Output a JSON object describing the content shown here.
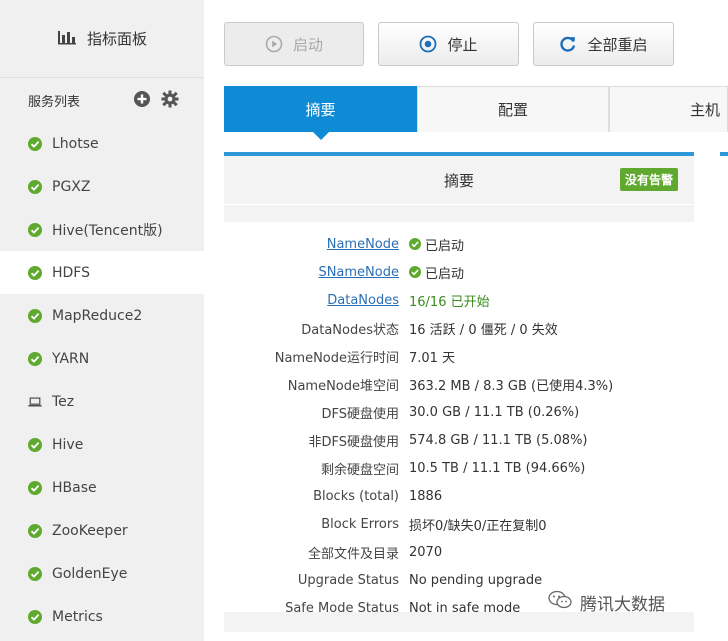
{
  "sidebar": {
    "title": "指标面板",
    "services_label": "服务列表",
    "items": [
      {
        "label": "Lhotse",
        "icon": "check-circle-icon"
      },
      {
        "label": "PGXZ",
        "icon": "check-circle-icon"
      },
      {
        "label": "Hive(Tencent版)",
        "icon": "check-circle-icon"
      },
      {
        "label": "HDFS",
        "icon": "none",
        "active": true
      },
      {
        "label": "MapReduce2",
        "icon": "check-circle-icon"
      },
      {
        "label": "YARN",
        "icon": "check-circle-icon"
      },
      {
        "label": "Tez",
        "icon": "laptop-icon"
      },
      {
        "label": "Hive",
        "icon": "check-circle-icon"
      },
      {
        "label": "HBase",
        "icon": "check-circle-icon"
      },
      {
        "label": "ZooKeeper",
        "icon": "check-circle-icon"
      },
      {
        "label": "GoldenEye",
        "icon": "check-circle-icon"
      },
      {
        "label": "Metrics",
        "icon": "check-circle-icon"
      }
    ]
  },
  "toolbar": {
    "start_label": "启动",
    "stop_label": "停止",
    "restart_label": "全部重启"
  },
  "tabs": [
    {
      "label": "摘要",
      "active": true
    },
    {
      "label": "配置"
    },
    {
      "label": "主机"
    }
  ],
  "panel": {
    "title": "摘要",
    "badge": "没有告警",
    "rows": [
      {
        "key": "NameNode",
        "value": "已启动"
      },
      {
        "key": "SNameNode",
        "value": "已启动"
      },
      {
        "key": "DataNodes",
        "value": "16/16 已开始"
      },
      {
        "key": "DataNodes状态",
        "value": "16 活跃 / 0 僵死 / 0 失效"
      },
      {
        "key": "NameNode运行时间",
        "value": "7.01 天"
      },
      {
        "key": "NameNode堆空间",
        "value": "363.2 MB / 8.3 GB (已使用4.3%)"
      },
      {
        "key": "DFS硬盘使用",
        "value": "30.0 GB / 11.1 TB (0.26%)"
      },
      {
        "key": "非DFS硬盘使用",
        "value": "574.8 GB / 11.1 TB (5.08%)"
      },
      {
        "key": "剩余硬盘空间",
        "value": "10.5 TB / 11.1 TB (94.66%)"
      },
      {
        "key": "Blocks (total)",
        "value": "1886"
      },
      {
        "key": "Block Errors",
        "value": "损坏0/缺失0/正在复制0"
      },
      {
        "key": "全部文件及目录",
        "value": "2070"
      },
      {
        "key": "Upgrade Status",
        "value": "No pending upgrade"
      },
      {
        "key": "Safe Mode Status",
        "value": "Not in safe mode"
      }
    ]
  },
  "watermark": "腾讯大数据",
  "colors": {
    "accent": "#0f8bd6",
    "success": "#5fa92e",
    "link": "#2a6fb5"
  }
}
